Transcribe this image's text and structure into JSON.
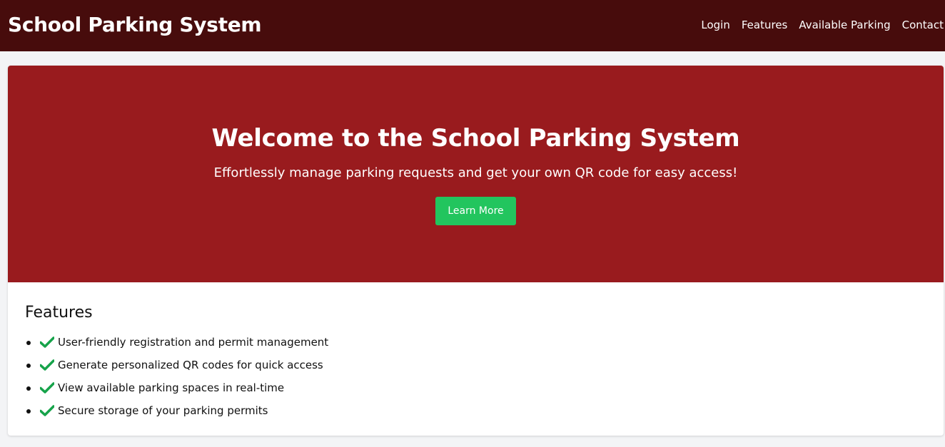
{
  "header": {
    "brand": "School Parking System",
    "nav": [
      "Login",
      "Features",
      "Available Parking",
      "Contact"
    ]
  },
  "hero": {
    "title": "Welcome to the School Parking System",
    "subtitle": "Effortlessly manage parking requests and get your own QR code for easy access!",
    "button_label": "Learn More"
  },
  "features": {
    "title": "Features",
    "items": [
      "User-friendly registration and permit management",
      "Generate personalized QR codes for quick access",
      "View available parking spaces in real-time",
      "Secure storage of your parking permits"
    ],
    "item_icon": "check-icon"
  },
  "colors": {
    "header_bg": "#470c0c",
    "hero_bg": "#991b1e",
    "button_bg": "#22c55e",
    "check_color": "#16a34a",
    "page_bg": "#f3f4f6"
  }
}
